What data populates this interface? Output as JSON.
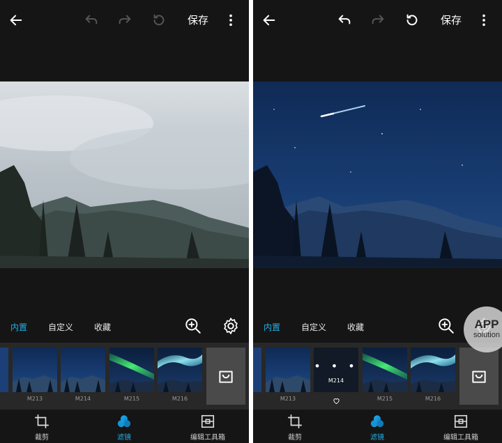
{
  "left": {
    "topbar": {
      "back_icon": "arrow-left-icon",
      "undo_icon": "undo-icon",
      "redo_icon": "redo-icon",
      "reset_icon": "reset-icon",
      "save_label": "保存",
      "more_icon": "more-vert-icon"
    },
    "tabs": {
      "builtin": "内置",
      "custom": "自定义",
      "favorites": "收藏"
    },
    "filters": [
      {
        "label": "M213"
      },
      {
        "label": "M214"
      },
      {
        "label": "M215"
      },
      {
        "label": "M216"
      }
    ],
    "nav": {
      "crop": "裁剪",
      "filter": "滤镜",
      "toolbox": "编辑工具箱"
    }
  },
  "right": {
    "topbar": {
      "save_label": "保存"
    },
    "tabs": {
      "builtin": "内置",
      "custom": "自定义",
      "favorites": "收藏"
    },
    "filters": [
      {
        "label": "M213"
      },
      {
        "label": "M214",
        "selected": true,
        "dots": "• • •"
      },
      {
        "label": "M215"
      },
      {
        "label": "M216"
      }
    ],
    "nav": {
      "crop": "裁剪",
      "filter": "滤镜",
      "toolbox": "编辑工具箱"
    }
  },
  "watermark": {
    "line1": "APP",
    "line2": "solution"
  },
  "colors": {
    "accent": "#1fb3e8",
    "background": "#151515",
    "strip": "#282828",
    "disabled_icon": "#555555"
  }
}
